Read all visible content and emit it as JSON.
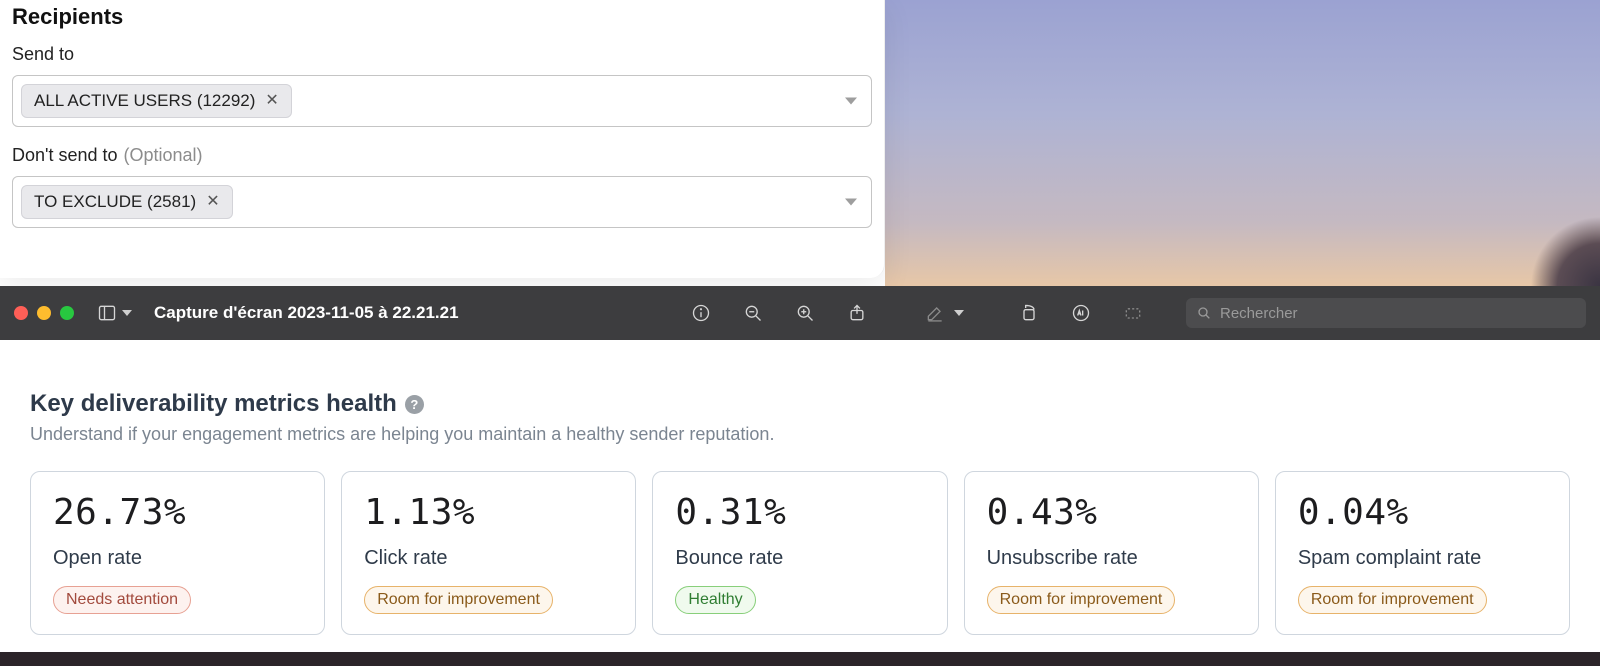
{
  "recipients": {
    "title": "Recipients",
    "send_to_label": "Send to",
    "send_to_chip": "ALL ACTIVE USERS (12292)",
    "dont_send_label": "Don't send to",
    "dont_send_optional": "(Optional)",
    "dont_send_chip": "TO EXCLUDE (2581)"
  },
  "preview": {
    "title": "Capture d'écran 2023-11-05 à 22.21.21",
    "search_placeholder": "Rechercher"
  },
  "metrics": {
    "heading": "Key deliverability metrics health",
    "sub": "Understand if your engagement metrics are helping you maintain a healthy sender reputation.",
    "cards": [
      {
        "value": "26.73%",
        "label": "Open rate",
        "status": "Needs attention",
        "status_kind": "red"
      },
      {
        "value": "1.13%",
        "label": "Click rate",
        "status": "Room for improvement",
        "status_kind": "orange"
      },
      {
        "value": "0.31%",
        "label": "Bounce rate",
        "status": "Healthy",
        "status_kind": "green"
      },
      {
        "value": "0.43%",
        "label": "Unsubscribe rate",
        "status": "Room for improvement",
        "status_kind": "orange"
      },
      {
        "value": "0.04%",
        "label": "Spam complaint rate",
        "status": "Room for improvement",
        "status_kind": "orange"
      }
    ]
  }
}
